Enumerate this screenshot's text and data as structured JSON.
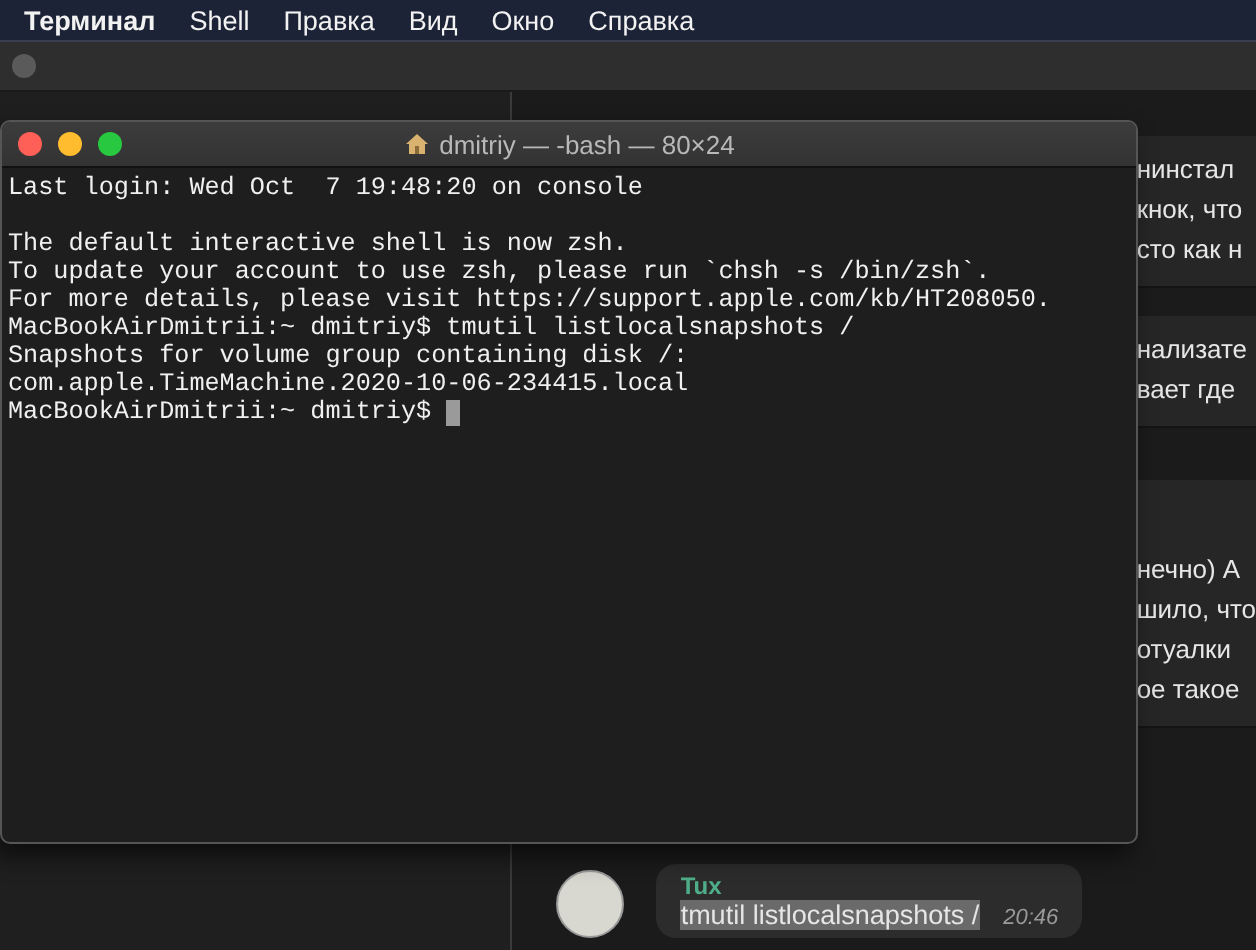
{
  "menu_bar": {
    "items": [
      {
        "label": "Терминал",
        "selected": true
      },
      {
        "label": "Shell",
        "selected": false
      },
      {
        "label": "Правка",
        "selected": false
      },
      {
        "label": "Вид",
        "selected": false
      },
      {
        "label": "Окно",
        "selected": false
      },
      {
        "label": "Справка",
        "selected": false
      }
    ]
  },
  "chat": {
    "messages": [
      {
        "lines": [
          "нинстал",
          "кнок, что",
          "сто как н"
        ]
      },
      {
        "lines": [
          "нализате",
          "вает где"
        ]
      },
      {
        "lines": [
          "нечно) А",
          "шило, что",
          "отуалки",
          "ое такое"
        ]
      }
    ],
    "last_message": {
      "sender": "Tux",
      "text": "tmutil listlocalsnapshots /",
      "selected_text": true,
      "time": "20:46"
    }
  },
  "terminal": {
    "title": "dmitriy — -bash — 80×24",
    "lines": [
      "Last login: Wed Oct  7 19:48:20 on console",
      {
        "kind": "blank"
      },
      "The default interactive shell is now zsh.",
      "To update your account to use zsh, please run `chsh -s /bin/zsh`.",
      "For more details, please visit https://support.apple.com/kb/HT208050.",
      "MacBookAirDmitrii:~ dmitriy$ tmutil listlocalsnapshots /",
      "Snapshots for volume group containing disk /:",
      "com.apple.TimeMachine.2020-10-06-234415.local"
    ],
    "prompt": "MacBookAirDmitrii:~ dmitriy$"
  }
}
